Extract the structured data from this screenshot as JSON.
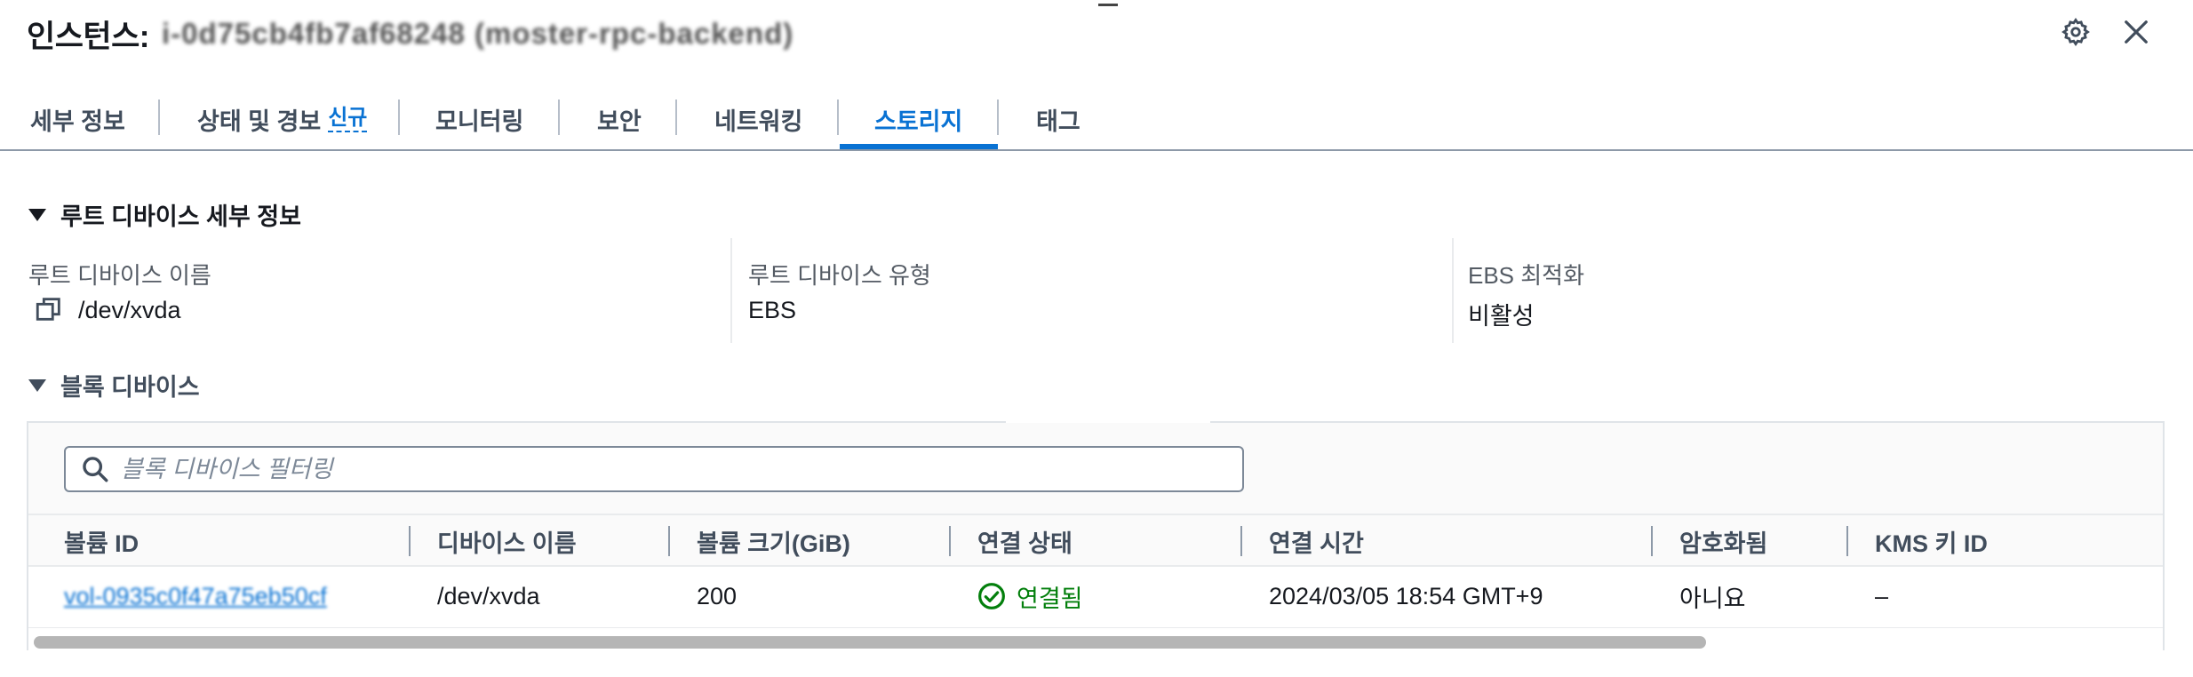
{
  "header": {
    "title": "인스턴스:",
    "instance_id": "i-0d75cb4fb7af68248 (moster-rpc-backend)"
  },
  "tabs": [
    {
      "label": "세부 정보"
    },
    {
      "label": "상태 및 경보",
      "badge": "신규"
    },
    {
      "label": "모니터링"
    },
    {
      "label": "보안"
    },
    {
      "label": "네트워킹"
    },
    {
      "label": "스토리지",
      "active": true
    },
    {
      "label": "태그"
    }
  ],
  "root_device": {
    "section_title": "루트 디바이스 세부 정보",
    "name_label": "루트 디바이스 이름",
    "name_value": "/dev/xvda",
    "type_label": "루트 디바이스 유형",
    "type_value": "EBS",
    "ebs_opt_label": "EBS 최적화",
    "ebs_opt_value": "비활성"
  },
  "block_devices": {
    "section_title": "블록 디바이스",
    "search_placeholder": "블록 디바이스 필터링",
    "columns": [
      "볼륨 ID",
      "디바이스 이름",
      "볼륨 크기(GiB)",
      "연결 상태",
      "연결 시간",
      "암호화됨",
      "KMS 키 ID"
    ],
    "rows": [
      {
        "volume_id": "vol-0935c0f47a75eb50cf",
        "device_name": "/dev/xvda",
        "size": "200",
        "attach_status": "연결됨",
        "attach_time": "2024/03/05 18:54 GMT+9",
        "encrypted": "아니요",
        "kms_key_id": "–"
      }
    ]
  },
  "colors": {
    "accent": "#0972d3",
    "success": "#037f0c",
    "text": "#16191f",
    "muted": "#545b64"
  }
}
